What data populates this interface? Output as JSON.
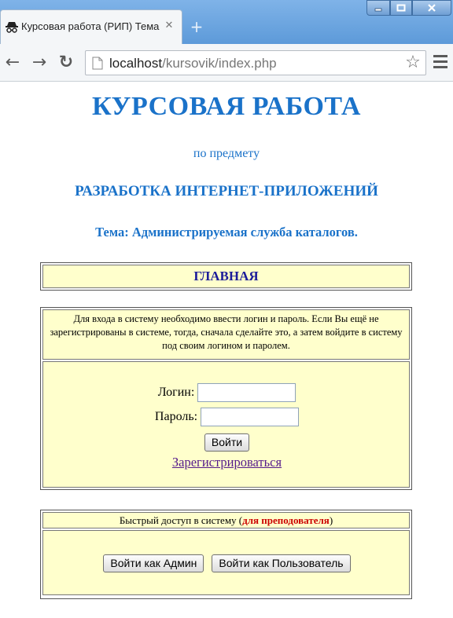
{
  "browser": {
    "tab_title": "Курсовая работа (РИП) Тема",
    "tab_close": "✕",
    "new_tab": "+",
    "url_host": "localhost",
    "url_path": "/kursovik/index.php",
    "nav_back": "←",
    "nav_forward": "→",
    "nav_reload": "↻",
    "star": "☆"
  },
  "header": {
    "title": "КУРСОВАЯ РАБОТА",
    "subtitle": "по предмету",
    "subject": "РАЗРАБОТКА ИНТЕРНЕТ-ПРИЛОЖЕНИЙ",
    "topic": "Тема: Администрируемая служба каталогов."
  },
  "nav": {
    "home_label": "ГЛАВНАЯ"
  },
  "login": {
    "info_text": "Для входа в систему необходимо ввести логин и пароль. Если Вы ещё не зарегистрированы в системе, тогда, сначала сделайте это, а затем войдите в систему под своим логином и паролем.",
    "login_label": "Логин:",
    "login_value": "",
    "password_label": "Пароль:",
    "password_value": "",
    "submit_label": "Войти",
    "register_label": "Зарегистрироваться"
  },
  "quick_access": {
    "head_prefix": "Быстрый доступ в систему (",
    "head_highlight": "для преподователя",
    "head_suffix": ")",
    "admin_button": "Войти как Админ",
    "user_button": "Войти как Пользователь"
  },
  "colors": {
    "heading": "#1a72c9",
    "cell_bg": "#ffffcc",
    "highlight": "#cc0000",
    "nav_text": "#1c1c9a"
  }
}
